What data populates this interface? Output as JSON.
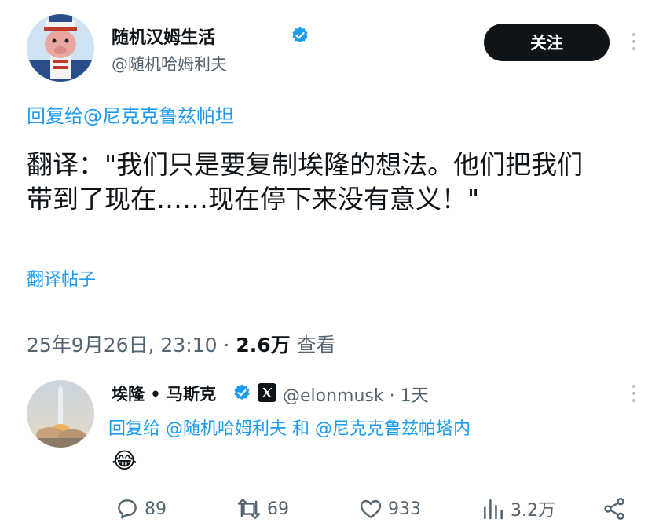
{
  "tweet": {
    "author_name": "随机汉姆生活",
    "author_handle": "@随机哈姆利夫",
    "follow_label": "关注",
    "reply_to": "回复给@尼克克鲁兹帕坦",
    "body": "翻译：\"我们只是要复制埃隆的想法。他们把我们带到了现在……现在停下来没有意义！\"",
    "translate_label": "翻译帖子",
    "timestamp": "25年9月26日, 23:10 · ",
    "views_count": "2.6万",
    "views_label": " 查看"
  },
  "reply": {
    "author_name": "埃隆 • 马斯克",
    "author_handle": "@elonmusk",
    "time": " · 1天",
    "reply_to": "回复给 @随机哈姆利夫 和 @尼克克鲁兹帕塔内",
    "emoji": "😂",
    "actions": {
      "replies": "89",
      "retweets": "69",
      "likes": "933",
      "views": "3.2万"
    }
  },
  "colors": {
    "accent": "#1d9bf0",
    "text": "#0f1419",
    "muted": "#536471"
  },
  "icons": [
    "verified-badge-icon",
    "x-logo-icon",
    "more-options-icon",
    "reply-icon",
    "retweet-icon",
    "like-icon",
    "views-icon",
    "share-icon"
  ]
}
